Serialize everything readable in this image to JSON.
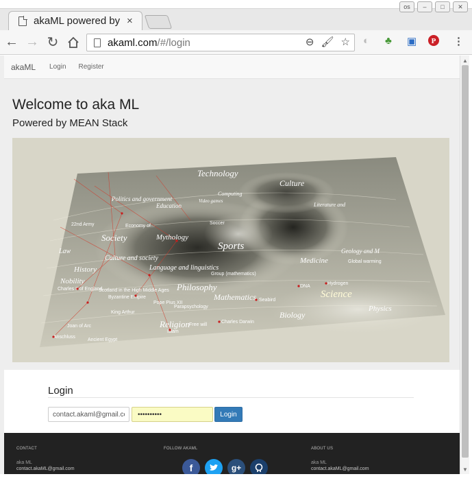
{
  "browser": {
    "tab_title": "akaML powered by MEAN",
    "tab_close": "×",
    "url_host": "akaml.com",
    "url_path": "/#/login",
    "window_buttons": [
      "os",
      "–",
      "□",
      "✕"
    ]
  },
  "site_nav": {
    "brand": "akaML",
    "links": [
      "Login",
      "Register"
    ]
  },
  "hero": {
    "title": "Welcome to aka ML",
    "subtitle": "Powered by MEAN Stack"
  },
  "map_labels": {
    "technology": "Technology",
    "culture": "Culture",
    "politics": "Politics and government",
    "education": "Education",
    "society": "Society",
    "mythology": "Mythology",
    "culture_society": "Culture and society",
    "sports": "Sports",
    "history": "History",
    "nobility": "Nobility",
    "language": "Language and linguistics",
    "medicine": "Medicine",
    "geology": "Geology and M",
    "philosophy": "Philosophy",
    "science": "Science",
    "mathematics": "Mathematics",
    "physics": "Physics",
    "biology": "Biology",
    "religion": "Religion",
    "law": "Law",
    "literature": "Literature and",
    "computing": "Computing",
    "video_games": "Video games",
    "soccer": "Soccer",
    "global_warming": "Global warming",
    "hydrogen": "Hydrogen",
    "dna": "DNA",
    "seabird": "Seabird",
    "group_math": "Group (mathematics)",
    "charles_darwin": "Charles Darwin",
    "free_will": "Free will",
    "islam": "Islam",
    "ancient_egypt": "Ancient Egypt",
    "anschluss": "Anschluss",
    "joan_of_arc": "Joan of Arc",
    "king_arthur": "King Arthur",
    "pope_pius": "Pope Pius XII",
    "parapsychology": "Parapsychology",
    "byzantine": "Byzantine Empire",
    "charles_ii": "Charles II of England",
    "scotland": "Scotland in the High Middle Ages",
    "economy": "Economy of...",
    "2nd_army": "22nd Army"
  },
  "login": {
    "heading": "Login",
    "email_value": "contact.akaml@gmail.com",
    "password_value": "••••••••••",
    "button": "Login"
  },
  "footer": {
    "contact_head": "CONTACT",
    "contact_name": "aka ML",
    "contact_email": "contact.akaML@gmail.com",
    "follow_head": "FOLLOW AKAML",
    "about_head": "ABOUT US",
    "about_name": "aka ML",
    "about_email": "contact.akaML@gmail.com"
  },
  "colors": {
    "login_button": "#337ab7",
    "footer_bg": "#222222",
    "facebook": "#3b5998",
    "twitter": "#1da1f2",
    "googleplus": "#2b4f7a",
    "github": "#1b3f6b"
  }
}
